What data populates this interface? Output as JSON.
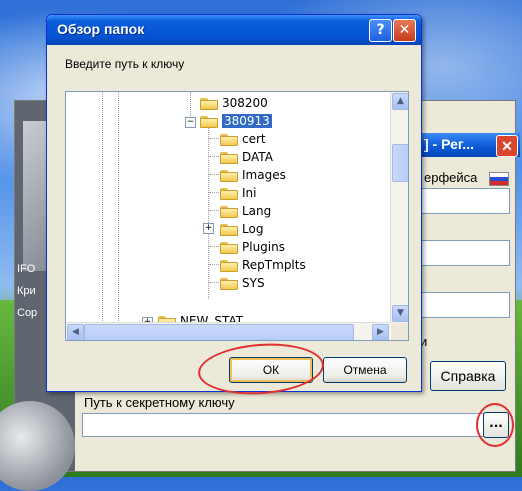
{
  "background_window": {
    "title_suffix": "] - Рег...",
    "language_label": "ерфейса",
    "side_labels": [
      "IFO",
      "Кри",
      "Сор"
    ],
    "letter_partial": "и",
    "help_button": "Справка",
    "secret_key_label": "Путь к секретному ключу",
    "browse_button": "..."
  },
  "dialog": {
    "title": "Обзор папок",
    "help_glyph": "?",
    "close_glyph": "✕",
    "prompt": "Введите путь к ключу",
    "tree": [
      {
        "label": "308200",
        "level": 0,
        "selected": false
      },
      {
        "label": "380913",
        "level": 0,
        "selected": true,
        "expanded": true
      },
      {
        "label": "cert",
        "level": 1
      },
      {
        "label": "DATA",
        "level": 1
      },
      {
        "label": "Images",
        "level": 1
      },
      {
        "label": "Ini",
        "level": 1
      },
      {
        "label": "Lang",
        "level": 1
      },
      {
        "label": "Log",
        "level": 1,
        "expandable": true
      },
      {
        "label": "Plugins",
        "level": 1
      },
      {
        "label": "RepTmplts",
        "level": 1
      },
      {
        "label": "SYS",
        "level": 1
      },
      {
        "label": "NEW_STAT",
        "level": -1,
        "expandable": true
      }
    ],
    "ok_button": "ОК",
    "cancel_button": "Отмена"
  }
}
